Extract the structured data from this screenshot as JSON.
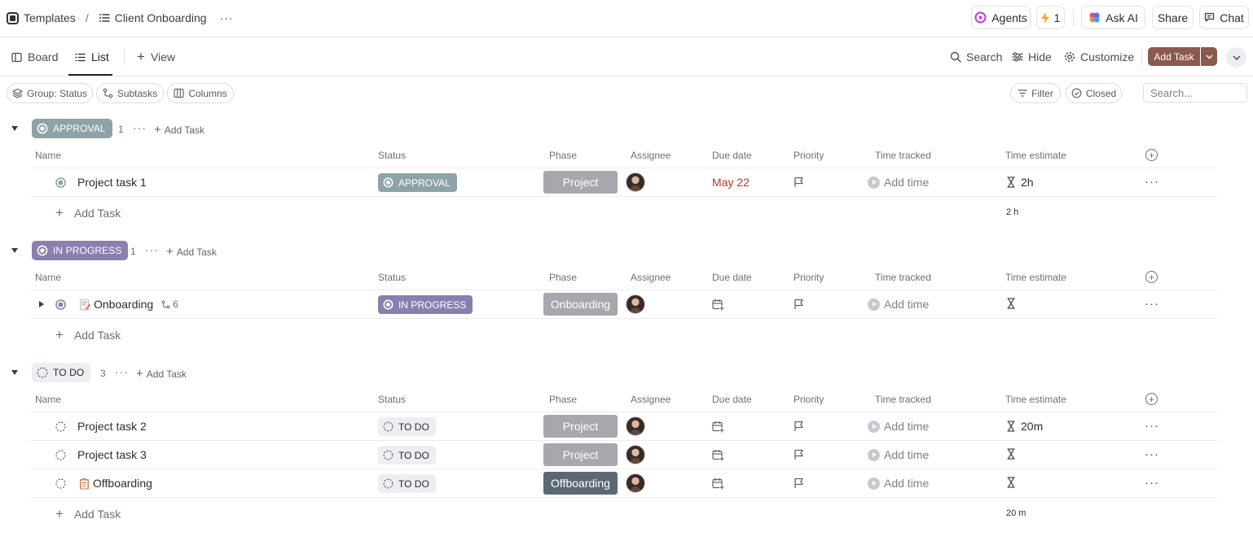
{
  "breadcrumb": {
    "workspace": "Templates",
    "separator": "/",
    "list_name": "Client Onboarding",
    "more": "···"
  },
  "top_actions": {
    "agents": "Agents",
    "automations_count": "1",
    "ask_ai": "Ask AI",
    "share": "Share",
    "chat": "Chat"
  },
  "views": {
    "board": "Board",
    "list": "List",
    "add_view": "View"
  },
  "toolbar": {
    "search": "Search",
    "hide": "Hide",
    "customize": "Customize",
    "add_task": "Add Task"
  },
  "filters": {
    "group": "Group: Status",
    "subtasks": "Subtasks",
    "columns": "Columns",
    "filter": "Filter",
    "closed": "Closed",
    "search_placeholder": "Search..."
  },
  "columns": {
    "name": "Name",
    "status": "Status",
    "phase": "Phase",
    "assignee": "Assignee",
    "due_date": "Due date",
    "priority": "Priority",
    "time_tracked": "Time tracked",
    "time_estimate": "Time estimate"
  },
  "labels": {
    "add_task": "Add Task",
    "add_time": "Add time",
    "more": "···"
  },
  "colors": {
    "approval": "#8ea3a7",
    "in_progress": "#8a7fae",
    "todo": "#eceef1",
    "phase_light": "#a6a8ad",
    "phase_dark": "#5d6876",
    "due_red": "#b5362e"
  },
  "groups": [
    {
      "status": "APPROVAL",
      "count": "1",
      "tasks": [
        {
          "name": "Project task 1",
          "status": "APPROVAL",
          "phase": "Project",
          "due": "May 22",
          "estimate": "2h"
        }
      ],
      "estimate_total": "2 h"
    },
    {
      "status": "IN PROGRESS",
      "count": "1",
      "tasks": [
        {
          "name": "Onboarding",
          "status": "IN PROGRESS",
          "phase": "Onboarding",
          "subtasks": "6",
          "estimate": ""
        }
      ],
      "estimate_total": ""
    },
    {
      "status": "TO DO",
      "count": "3",
      "tasks": [
        {
          "name": "Project task 2",
          "status": "TO DO",
          "phase": "Project",
          "estimate": "20m"
        },
        {
          "name": "Project task 3",
          "status": "TO DO",
          "phase": "Project",
          "estimate": ""
        },
        {
          "name": "Offboarding",
          "status": "TO DO",
          "phase": "Offboarding",
          "estimate": ""
        }
      ],
      "estimate_total": "20 m"
    }
  ]
}
